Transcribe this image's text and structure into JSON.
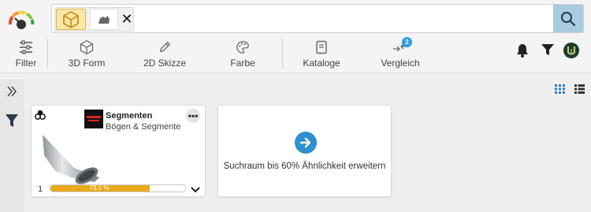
{
  "search": {
    "chip_close_label": "✕"
  },
  "toolbar": {
    "filter_label": "Filter",
    "form3d_label": "3D Form",
    "sketch2d_label": "2D Skizze",
    "color_label": "Farbe",
    "catalogs_label": "Kataloge",
    "compare_label": "Vergleich",
    "compare_badge": "2"
  },
  "result": {
    "title": "Segmenten",
    "subtitle": "Bögen & Segmente",
    "more_label": "•••",
    "count": "1",
    "similarity_text": "73.1 %",
    "similarity_value": 0.731
  },
  "expand_search": {
    "text": "Suchraum bis 60% Ähnlichkeit erweitern"
  },
  "colors": {
    "accent_blue": "#2d8ed0",
    "search_button": "#a8cbe0",
    "progress_fill": "#e8ab1e",
    "chip_highlight": "#fbe7a8"
  },
  "icons": {
    "gauge": "similarity-gauge-icon",
    "search": "search-icon",
    "filter": "sliders-icon",
    "form3d": "cube-icon",
    "sketch": "pencil-icon",
    "color": "palette-icon",
    "catalogs": "catalog-book-icon",
    "compare": "compare-arrows-icon",
    "notifications": "bell-icon",
    "funnel": "funnel-icon",
    "user": "user-avatar-icon",
    "collapse": "double-chevron-right-icon",
    "grid_view": "grid-view-icon",
    "list_view": "list-view-icon"
  }
}
